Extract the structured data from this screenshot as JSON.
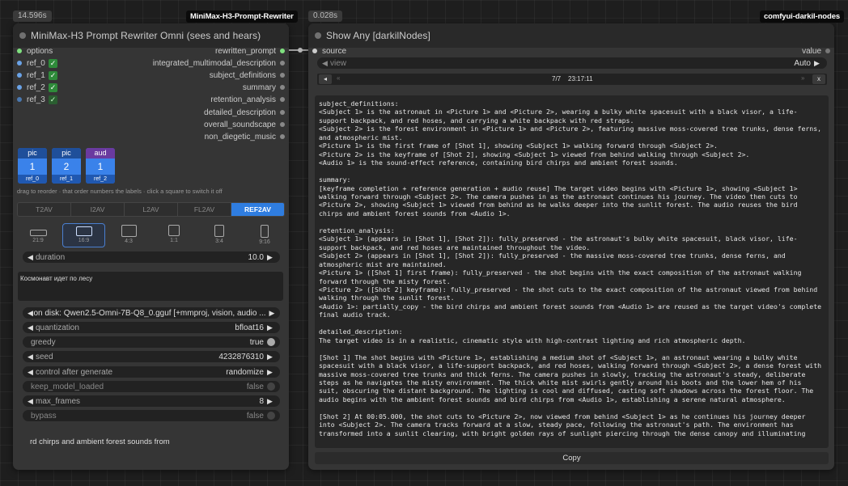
{
  "left_node": {
    "timing": "14.596s",
    "badge": "MiniMax-H3-Prompt-Rewriter",
    "title": "MiniMax-H3 Prompt Rewriter Omni (sees and hears)",
    "inputs": [
      {
        "label": "options"
      },
      {
        "label": "ref_0"
      },
      {
        "label": "ref_1"
      },
      {
        "label": "ref_2"
      },
      {
        "label": "ref_3"
      }
    ],
    "outputs": [
      "rewritten_prompt",
      "integrated_multimodal_description",
      "subject_definitions",
      "summary",
      "retention_analysis",
      "detailed_description",
      "overall_soundscape",
      "non_diegetic_music"
    ],
    "tiles": [
      {
        "type": "pic",
        "num": "1",
        "ref": "ref_0"
      },
      {
        "type": "pic",
        "num": "2",
        "ref": "ref_1"
      },
      {
        "type": "aud",
        "num": "1",
        "ref": "ref_2"
      }
    ],
    "hint": "drag to reorder · that order numbers the labels · click a square to switch it off",
    "tabs": [
      "T2AV",
      "I2AV",
      "L2AV",
      "FL2AV",
      "REF2AV"
    ],
    "active_tab": "REF2AV",
    "aspects": [
      "21:9",
      "16:9",
      "4:3",
      "1:1",
      "3:4",
      "9:16"
    ],
    "selected_aspect": "16:9",
    "duration": {
      "label": "duration",
      "value": "10.0"
    },
    "prompt_text": "Космонавт идет по лесу",
    "widgets": [
      {
        "label": "on disk: Qwen2.5-Omni-7B-Q8_0.gguf [+mmproj, vision, audio ...",
        "value": "",
        "type": "combo"
      },
      {
        "label": "quantization",
        "value": "bfloat16",
        "type": "combo"
      },
      {
        "label": "greedy",
        "value": "true",
        "type": "toggle-on"
      },
      {
        "label": "seed",
        "value": "4232876310",
        "type": "number"
      },
      {
        "label": "control after generate",
        "value": "randomize",
        "type": "combo"
      },
      {
        "label": "keep_model_loaded",
        "value": "false",
        "type": "toggle-off"
      },
      {
        "label": "max_frames",
        "value": "8",
        "type": "number"
      },
      {
        "label": "bypass",
        "value": "false",
        "type": "toggle-off"
      }
    ],
    "bottom_text": "rd chirps and ambient forest sounds from"
  },
  "right_node": {
    "timing": "0.028s",
    "badge": "comfyui-darkil-nodes",
    "title": "Show Any [darkilNodes]",
    "input": "source",
    "output": "value",
    "view": {
      "label": "view",
      "value": "Auto"
    },
    "pager": {
      "prev": "◂",
      "first": "«",
      "count": "7/7",
      "time": "23:17:11",
      "last": "»",
      "close": "x"
    },
    "preview_text": "subject_definitions:\n<Subject 1> is the astronaut in <Picture 1> and <Picture 2>, wearing a bulky white spacesuit with a black visor, a life-support backpack, and red hoses, and carrying a white backpack with red straps.\n<Subject 2> is the forest environment in <Picture 1> and <Picture 2>, featuring massive moss-covered tree trunks, dense ferns, and atmospheric mist.\n<Picture 1> is the first frame of [Shot 1], showing <Subject 1> walking forward through <Subject 2>.\n<Picture 2> is the keyframe of [Shot 2], showing <Subject 1> viewed from behind walking through <Subject 2>.\n<Audio 1> is the sound-effect reference, containing bird chirps and ambient forest sounds.\n\nsummary:\n[keyframe completion + reference generation + audio reuse] The target video begins with <Picture 1>, showing <Subject 1> walking forward through <Subject 2>. The camera pushes in as the astronaut continues his journey. The video then cuts to <Picture 2>, showing <Subject 1> viewed from behind as he walks deeper into the sunlit forest. The audio reuses the bird chirps and ambient forest sounds from <Audio 1>.\n\nretention_analysis:\n<Subject 1> (appears in [Shot 1], [Shot 2]): fully_preserved - the astronaut's bulky white spacesuit, black visor, life-support backpack, and red hoses are maintained throughout the video.\n<Subject 2> (appears in [Shot 1], [Shot 2]): fully_preserved - the massive moss-covered tree trunks, dense ferns, and atmospheric mist are maintained.\n<Picture 1> ([Shot 1] first frame): fully_preserved - the shot begins with the exact composition of the astronaut walking forward through the misty forest.\n<Picture 2> ([Shot 2] keyframe): fully_preserved - the shot cuts to the exact composition of the astronaut viewed from behind walking through the sunlit forest.\n<Audio 1>: partially_copy - the bird chirps and ambient forest sounds from <Audio 1> are reused as the target video's complete final audio track.\n\ndetailed_description:\nThe target video is in a realistic, cinematic style with high-contrast lighting and rich atmospheric depth.\n\n[Shot 1] The shot begins with <Picture 1>, establishing a medium shot of <Subject 1>, an astronaut wearing a bulky white spacesuit with a black visor, a life-support backpack, and red hoses, walking forward through <Subject 2>, a dense forest with massive moss-covered tree trunks and thick ferns. The camera pushes in slowly, tracking the astronaut's steady, deliberate steps as he navigates the misty environment. The thick white mist swirls gently around his boots and the lower hem of his suit, obscuring the distant background. The lighting is cool and diffused, casting soft shadows across the forest floor. The audio begins with the ambient forest sounds and bird chirps from <Audio 1>, establishing a serene natural atmosphere.\n\n[Shot 2] At 00:05.000, the shot cuts to <Picture 2>, now viewed from behind <Subject 1> as he continues his journey deeper into <Subject 2>. The camera tracks forward at a slow, steady pace, following the astronaut's path. The environment has transformed into a sunlit clearing, with bright golden rays of sunlight piercing through the dense canopy and illuminating",
    "copy_label": "Copy"
  }
}
